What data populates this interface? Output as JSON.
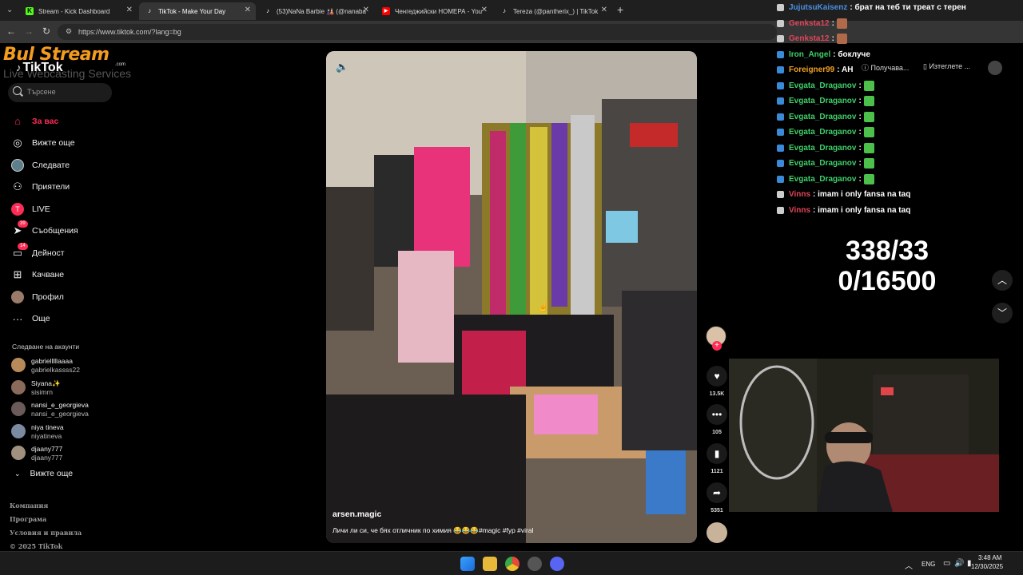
{
  "browser": {
    "tabs": [
      {
        "label": "Stream - Kick Dashboard",
        "active": false
      },
      {
        "label": "TikTok - Make Your Day",
        "active": true
      },
      {
        "label": "(53)NaNa Barbie 🎎 (@nanaba",
        "active": false
      },
      {
        "label": "Ченгеджийски НОМЕРА - You",
        "active": false
      },
      {
        "label": "Tereza (@pantherix_) | TikTok",
        "active": false
      }
    ],
    "url": "https://www.tiktok.com/?lang=bg",
    "extension_buttons": {
      "receive": "Получава...",
      "download": "Изтеглете ..."
    }
  },
  "overlay": {
    "brand": "Bul Stream",
    "brand_com": ".com",
    "brand_sub": "Live Webcasting Services"
  },
  "tiktok": {
    "logo": "TikTok",
    "search_placeholder": "Търсене",
    "nav": [
      {
        "label": "За вас",
        "icon": "home-icon",
        "active": true
      },
      {
        "label": "Вижте още",
        "icon": "compass-icon"
      },
      {
        "label": "Следвате",
        "icon": "following-avatar-icon"
      },
      {
        "label": "Приятели",
        "icon": "friends-icon"
      },
      {
        "label": "LIVE",
        "icon": "live-icon"
      },
      {
        "label": "Съобщения",
        "icon": "messages-icon",
        "badge": "39"
      },
      {
        "label": "Дейност",
        "icon": "activity-icon",
        "badge": "14"
      },
      {
        "label": "Качване",
        "icon": "upload-icon"
      },
      {
        "label": "Профил",
        "icon": "profile-avatar-icon"
      },
      {
        "label": "Още",
        "icon": "more-icon"
      }
    ],
    "following_title": "Следване на акаунти",
    "accounts": [
      {
        "name": "gabrielllllaaaa",
        "handle": "gabrielkassss22",
        "color": "#b88a5a"
      },
      {
        "name": "Siyana✨",
        "handle": "sisimrn",
        "color": "#8a6a5a"
      },
      {
        "name": "nansi_e_georgieva",
        "handle": "nansi_e_georgieva",
        "color": "#6a5a5a"
      },
      {
        "name": "niya tineva",
        "handle": "niyatineva",
        "color": "#7a8aa0"
      },
      {
        "name": "djaany777",
        "handle": "djaany777",
        "color": "#a09080"
      }
    ],
    "see_more": "Вижте още",
    "footer": [
      "Компания",
      "Програма",
      "Условия и правила",
      "© 2025 TikTok"
    ],
    "video": {
      "username": "arsen.magic",
      "caption": "Личи ли си, че бях отличник по химия 😂😂😂#magic #fyp #viral"
    },
    "actions": {
      "likes": "13.5K",
      "comments": "105",
      "saves": "1121",
      "shares": "5351"
    }
  },
  "chat": [
    {
      "name": "JujutsuKaisenz",
      "name_color": "#4a90e2",
      "msg": ": брат на теб ти треат с терен"
    },
    {
      "name": "Genksta12",
      "name_color": "#e0455a",
      "msg": ":",
      "emote": true
    },
    {
      "name": "Genksta12",
      "name_color": "#e0455a",
      "msg": ":",
      "emote": true
    },
    {
      "name": "Iron_Angel",
      "name_color": "#3fd06a",
      "msg": ": боклуче"
    },
    {
      "name": "Foreigner99",
      "name_color": "#f0a020",
      "msg": ": AH"
    },
    {
      "name": "Evgata_Draganov",
      "name_color": "#3fd06a",
      "msg": ":",
      "emote": true
    },
    {
      "name": "Evgata_Draganov",
      "name_color": "#3fd06a",
      "msg": ":",
      "emote": true
    },
    {
      "name": "Evgata_Draganov",
      "name_color": "#3fd06a",
      "msg": ":",
      "emote": true
    },
    {
      "name": "Evgata_Draganov",
      "name_color": "#3fd06a",
      "msg": ":",
      "emote": true
    },
    {
      "name": "Evgata_Draganov",
      "name_color": "#3fd06a",
      "msg": ":",
      "emote": true
    },
    {
      "name": "Evgata_Draganov",
      "name_color": "#3fd06a",
      "msg": ":",
      "emote": true
    },
    {
      "name": "Evgata_Draganov",
      "name_color": "#3fd06a",
      "msg": ":",
      "emote": true
    },
    {
      "name": "Vinns",
      "name_color": "#e0455a",
      "msg": ": imam i only fansa na taq"
    },
    {
      "name": "Vinns",
      "name_color": "#e0455a",
      "msg": ": imam i only fansa na taq"
    }
  ],
  "counter": {
    "line1": "338/33",
    "line2": "0/16500"
  },
  "taskbar": {
    "lang": "ENG",
    "time": "3:48 AM",
    "date": "12/30/2025"
  }
}
